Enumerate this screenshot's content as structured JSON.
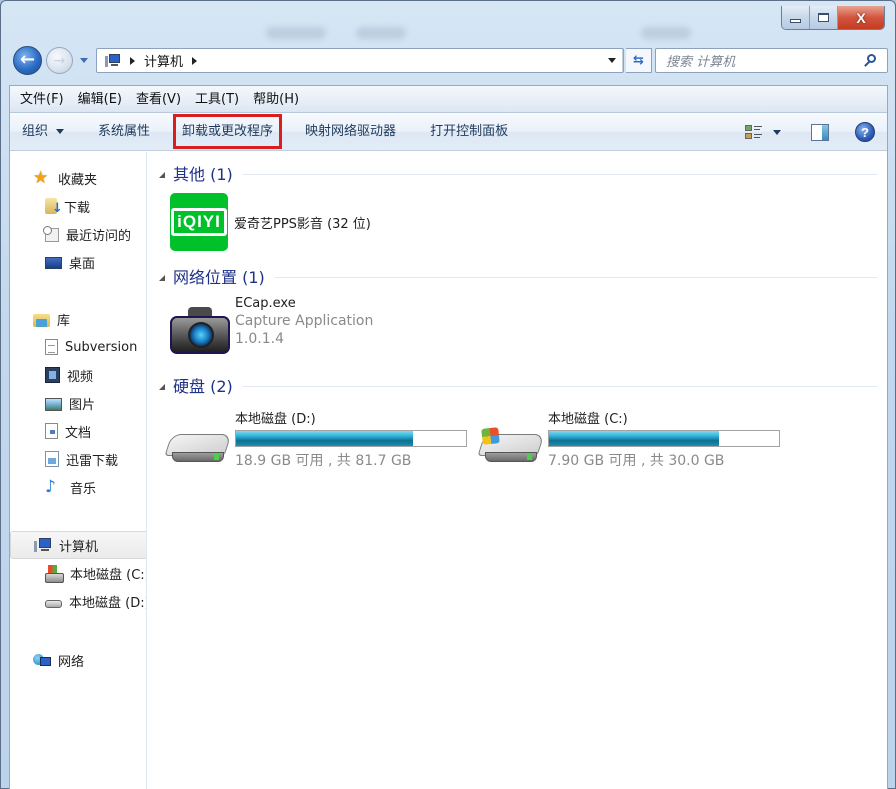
{
  "window": {
    "caption": {
      "minimize_icon": "minimize-icon",
      "maximize_icon": "maximize-icon",
      "close_label": "X"
    }
  },
  "nav": {
    "back_glyph": "←",
    "forward_glyph": "→",
    "breadcrumb": [
      "计算机"
    ],
    "refresh_glyph": "⇆",
    "search_placeholder": "搜索 计算机"
  },
  "menubar": {
    "items": [
      "文件(F)",
      "编辑(E)",
      "查看(V)",
      "工具(T)",
      "帮助(H)"
    ]
  },
  "toolbar": {
    "organize": "组织",
    "system_properties": "系统属性",
    "uninstall": "卸载或更改程序",
    "map_drive": "映射网络驱动器",
    "control_panel": "打开控制面板",
    "highlight_color": "#d81e1e",
    "help_glyph": "?"
  },
  "sidebar": {
    "favorites": {
      "label": "收藏夹",
      "items": [
        "下载",
        "最近访问的",
        "桌面"
      ]
    },
    "libraries": {
      "label": "库",
      "items": [
        "Subversion",
        "视频",
        "图片",
        "文档",
        "迅雷下载",
        "音乐"
      ]
    },
    "computer": {
      "label": "计算机",
      "selected": true,
      "items": [
        "本地磁盘 (C:)",
        "本地磁盘 (D:)"
      ]
    },
    "network": {
      "label": "网络"
    }
  },
  "content": {
    "groups": [
      {
        "title": "其他 (1)",
        "items": [
          {
            "name": "爱奇艺PPS影音 (32 位)",
            "icon_text": "iQIYI"
          }
        ]
      },
      {
        "title": "网络位置 (1)",
        "items": [
          {
            "name": "ECap.exe",
            "description": "Capture Application",
            "version": "1.0.1.4"
          }
        ]
      },
      {
        "title": "硬盘 (2)",
        "drives": [
          {
            "name": "本地磁盘 (D:)",
            "free_text": "18.9 GB 可用 , 共 81.7 GB",
            "free_gb": 18.9,
            "total_gb": 81.7,
            "used_percent": 76.9
          },
          {
            "name": "本地磁盘 (C:)",
            "free_text": "7.90 GB 可用 , 共 30.0 GB",
            "free_gb": 7.9,
            "total_gb": 30.0,
            "used_percent": 73.7
          }
        ]
      }
    ]
  }
}
